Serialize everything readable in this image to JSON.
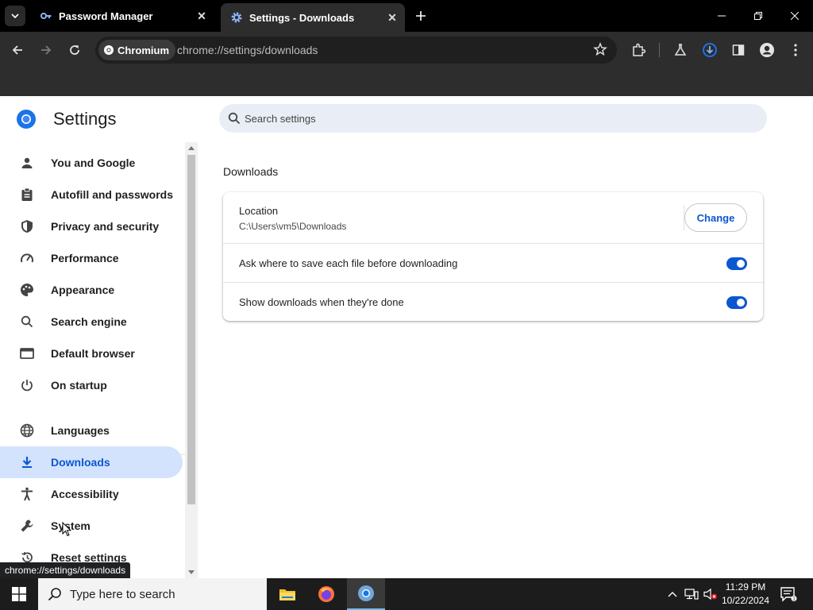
{
  "browser": {
    "tabs": [
      {
        "title": "Password Manager",
        "icon": "key-icon",
        "active": false
      },
      {
        "title": "Settings - Downloads",
        "icon": "gear-icon",
        "active": true
      }
    ],
    "omnibox": {
      "chip_label": "Chromium",
      "url": "chrome://settings/downloads"
    },
    "status_url": "chrome://settings/downloads"
  },
  "settings": {
    "title": "Settings",
    "search_placeholder": "Search settings",
    "nav": [
      {
        "label": "You and Google",
        "icon": "person-icon"
      },
      {
        "label": "Autofill and passwords",
        "icon": "clipboard-icon"
      },
      {
        "label": "Privacy and security",
        "icon": "shield-icon"
      },
      {
        "label": "Performance",
        "icon": "speedometer-icon"
      },
      {
        "label": "Appearance",
        "icon": "palette-icon"
      },
      {
        "label": "Search engine",
        "icon": "search-icon"
      },
      {
        "label": "Default browser",
        "icon": "browser-window-icon"
      },
      {
        "label": "On startup",
        "icon": "power-icon"
      },
      {
        "label": "Languages",
        "icon": "globe-icon"
      },
      {
        "label": "Downloads",
        "icon": "download-icon",
        "selected": true
      },
      {
        "label": "Accessibility",
        "icon": "accessibility-icon"
      },
      {
        "label": "System",
        "icon": "wrench-icon"
      },
      {
        "label": "Reset settings",
        "icon": "history-icon"
      }
    ],
    "section_title": "Downloads",
    "location": {
      "label": "Location",
      "path": "C:\\Users\\vm5\\Downloads",
      "button": "Change"
    },
    "toggles": [
      {
        "label": "Ask where to save each file before downloading",
        "on": true
      },
      {
        "label": "Show downloads when they're done",
        "on": true
      }
    ],
    "accent_color": "#0b57d0",
    "selected_bg": "#d3e3fd"
  },
  "taskbar": {
    "search_placeholder": "Type here to search",
    "time": "11:29 PM",
    "date": "10/22/2024"
  }
}
